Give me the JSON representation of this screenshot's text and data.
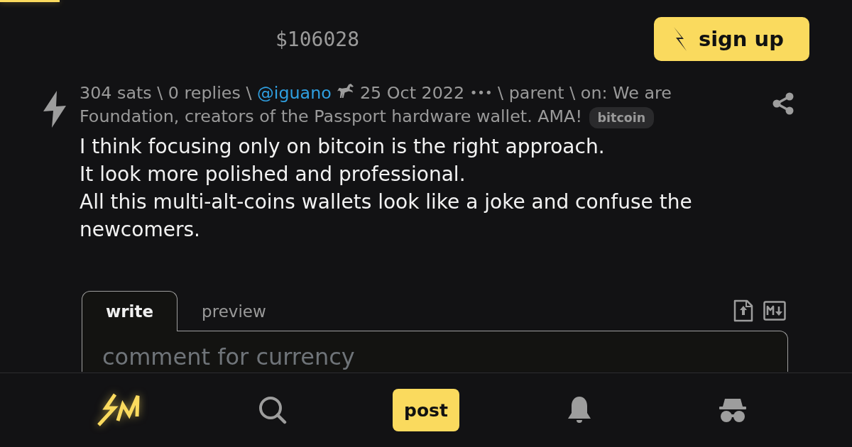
{
  "header": {
    "price": "$106028",
    "signup_button": "sign up"
  },
  "comment": {
    "meta": [
      {
        "kind": "text",
        "text": "304 sats \\ 0 replies \\"
      },
      {
        "kind": "user",
        "text": "@iguano"
      },
      {
        "kind": "text",
        "text": "25 Oct 2022"
      },
      {
        "kind": "menu",
        "text": "•••"
      },
      {
        "kind": "text",
        "text": "\\ parent \\ on: We are Foundation, creators of the Passport hardware wallet. AMA!"
      }
    ],
    "tag": "bitcoin",
    "body": "I think focusing only on bitcoin is the right approach.\nIt look more polished and professional.\nAll this multi-alt-coins wallets look like a joke and confuse the newcomers."
  },
  "editor": {
    "tabs": [
      {
        "label": "write",
        "selected": true
      },
      {
        "label": "preview",
        "selected": false
      }
    ],
    "placeholder": "comment for currency"
  },
  "bottom_nav": {
    "post_button": "post"
  }
}
